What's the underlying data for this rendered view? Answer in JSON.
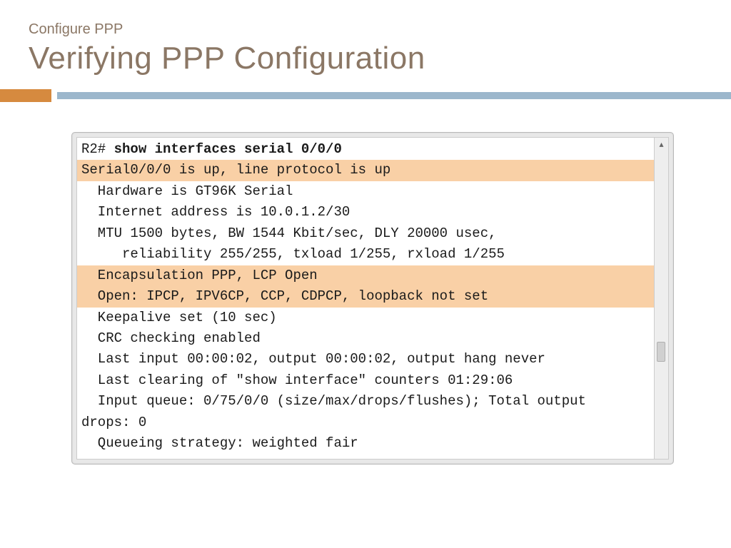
{
  "header": {
    "subtitle": "Configure PPP",
    "title": "Verifying PPP Configuration"
  },
  "terminal": {
    "prompt": "R2# ",
    "command": "show interfaces serial 0/0/0",
    "lines": [
      {
        "text": "Serial0/0/0 is up, line protocol is up",
        "hl": true
      },
      {
        "text": "  Hardware is GT96K Serial",
        "hl": false
      },
      {
        "text": "  Internet address is 10.0.1.2/30",
        "hl": false
      },
      {
        "text": "  MTU 1500 bytes, BW 1544 Kbit/sec, DLY 20000 usec,",
        "hl": false
      },
      {
        "text": "     reliability 255/255, txload 1/255, rxload 1/255",
        "hl": false
      },
      {
        "text": "  Encapsulation PPP, LCP Open",
        "hl": true
      },
      {
        "text": "  Open: IPCP, IPV6CP, CCP, CDPCP, loopback not set",
        "hl": true
      },
      {
        "text": "  Keepalive set (10 sec)",
        "hl": false
      },
      {
        "text": "  CRC checking enabled",
        "hl": false
      },
      {
        "text": "  Last input 00:00:02, output 00:00:02, output hang never",
        "hl": false
      },
      {
        "text": "  Last clearing of \"show interface\" counters 01:29:06",
        "hl": false
      },
      {
        "text": "  Input queue: 0/75/0/0 (size/max/drops/flushes); Total output",
        "hl": false
      },
      {
        "text": "drops: 0",
        "hl": false
      },
      {
        "text": "  Queueing strategy: weighted fair",
        "hl": false
      }
    ]
  }
}
